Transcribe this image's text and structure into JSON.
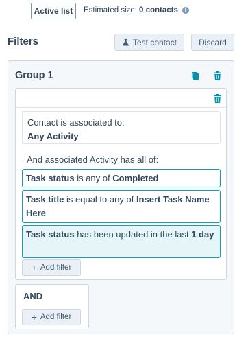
{
  "topbar": {
    "list_type_label": "Active list",
    "estimated_prefix": "Estimated size:",
    "estimated_value": "0 contacts",
    "info_icon": "info-icon"
  },
  "filters": {
    "title": "Filters",
    "test_contact_label": "Test contact",
    "discard_label": "Discard"
  },
  "group": {
    "title": "Group 1",
    "association": {
      "prefix": "Contact is associated to:",
      "value": "Any Activity"
    },
    "and_associated_text": "And associated Activity has all of:",
    "conditions": [
      {
        "property": "Task status",
        "operator": "is any of",
        "value": "Completed"
      },
      {
        "property": "Task title",
        "operator": "is equal to any of",
        "value": "Insert Task Name Here"
      },
      {
        "property": "Task status",
        "operator": "has been updated in the last",
        "value": "1 day"
      }
    ],
    "add_filter_label": "Add filter"
  },
  "and_block": {
    "label": "AND",
    "add_filter_label": "Add filter"
  },
  "colors": {
    "accent": "#00a4bd",
    "text": "#33475b",
    "border": "#cbd6e2",
    "button_bg": "#eaf0f6",
    "highlight_bg": "#e5f5f8"
  }
}
